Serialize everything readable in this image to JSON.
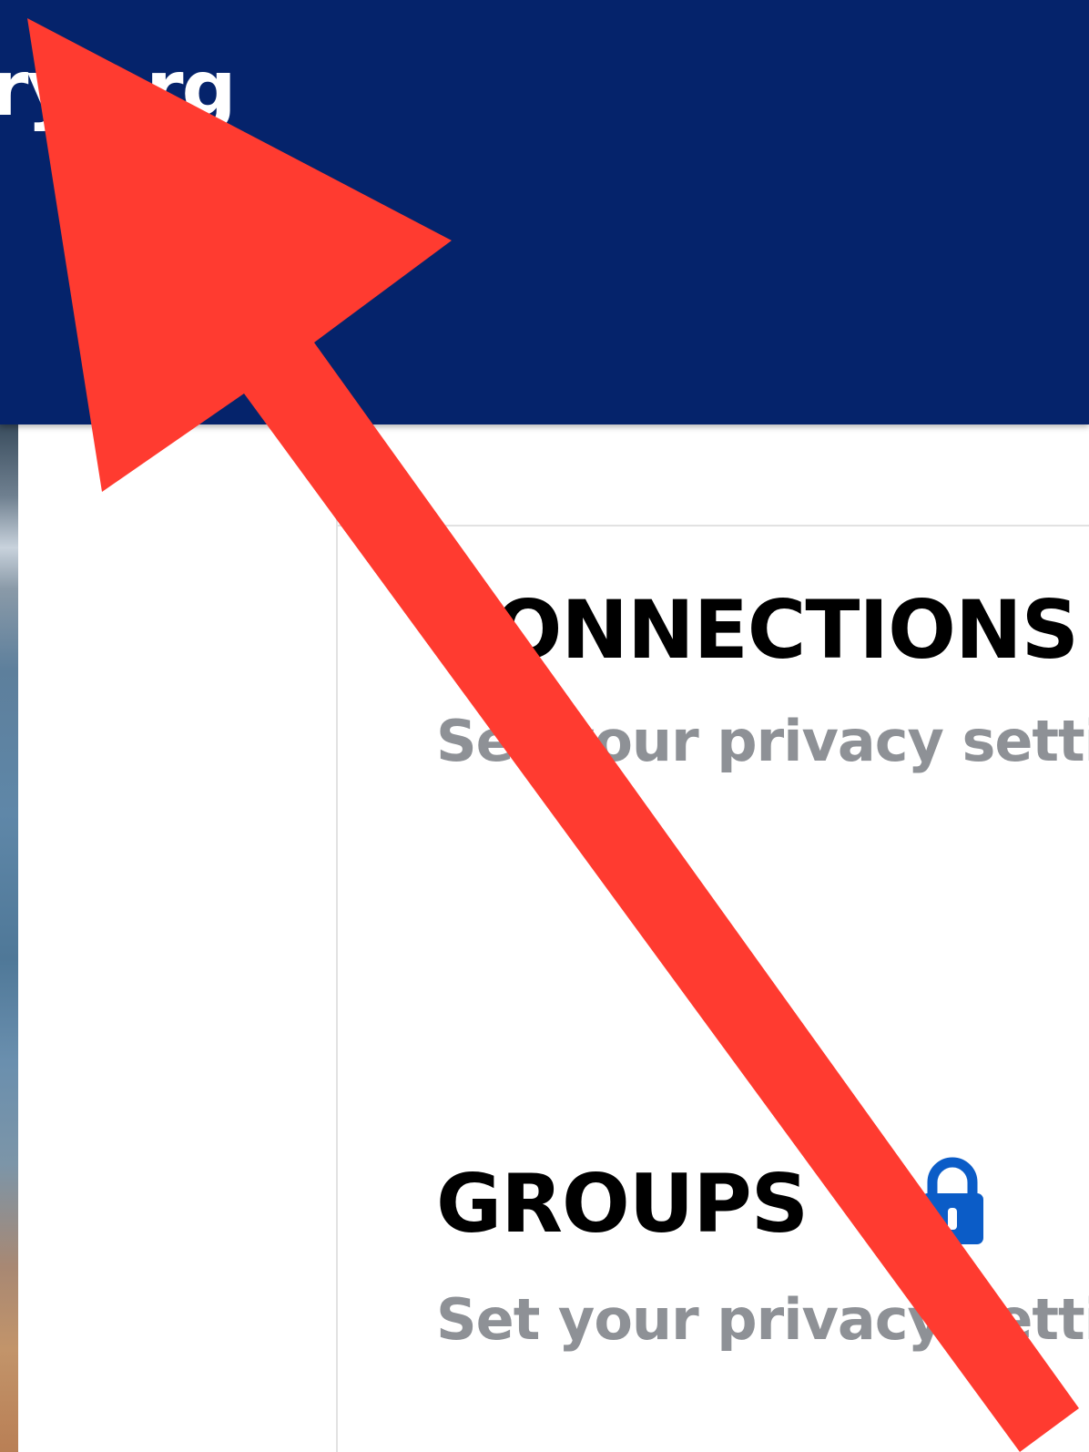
{
  "header": {
    "site_name": "ry.org",
    "background_color": "#05236b"
  },
  "sections": [
    {
      "title": "CONNECTIONS",
      "description": "Set your privacy settings"
    },
    {
      "title": "GROUPS",
      "description": "Set your privacy settings",
      "icon": "lock-icon",
      "icon_color": "#0b5cc7"
    }
  ],
  "annotation": {
    "icon": "arrow-icon",
    "color": "#ff3b30"
  }
}
